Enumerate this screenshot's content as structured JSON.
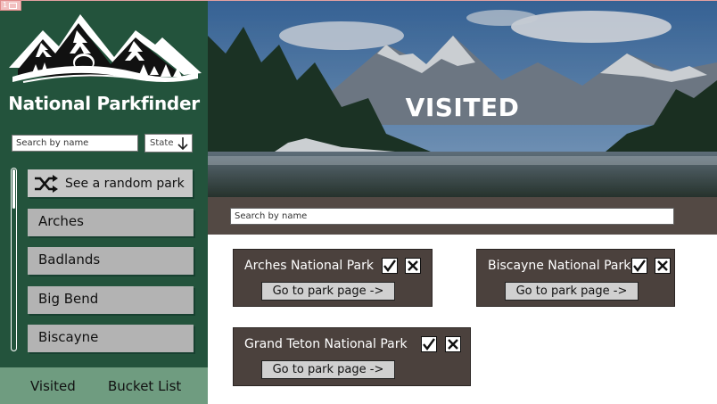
{
  "frame": {
    "number": "1"
  },
  "app": {
    "title": "National Parkfinder"
  },
  "sidebar": {
    "search_placeholder": "Search by name",
    "state_label": "State",
    "random_label": "See a random park",
    "parks": [
      {
        "label": "Arches"
      },
      {
        "label": "Badlands"
      },
      {
        "label": "Big Bend"
      },
      {
        "label": "Biscayne"
      }
    ],
    "nav": {
      "visited": "Visited",
      "bucket": "Bucket List"
    }
  },
  "hero": {
    "title": "VISITED"
  },
  "filter": {
    "placeholder": "Search by name"
  },
  "cards": [
    {
      "name": "Arches National Park",
      "button": "Go to park page ->"
    },
    {
      "name": "Biscayne National Park",
      "button": "Go to park page ->"
    },
    {
      "name": "Grand Teton National Park",
      "button": "Go to park page ->"
    }
  ],
  "colors": {
    "sidebar": "#23533c",
    "bottom_nav": "#6f9c80",
    "card": "#4b413d",
    "filter_bar": "#534944"
  }
}
